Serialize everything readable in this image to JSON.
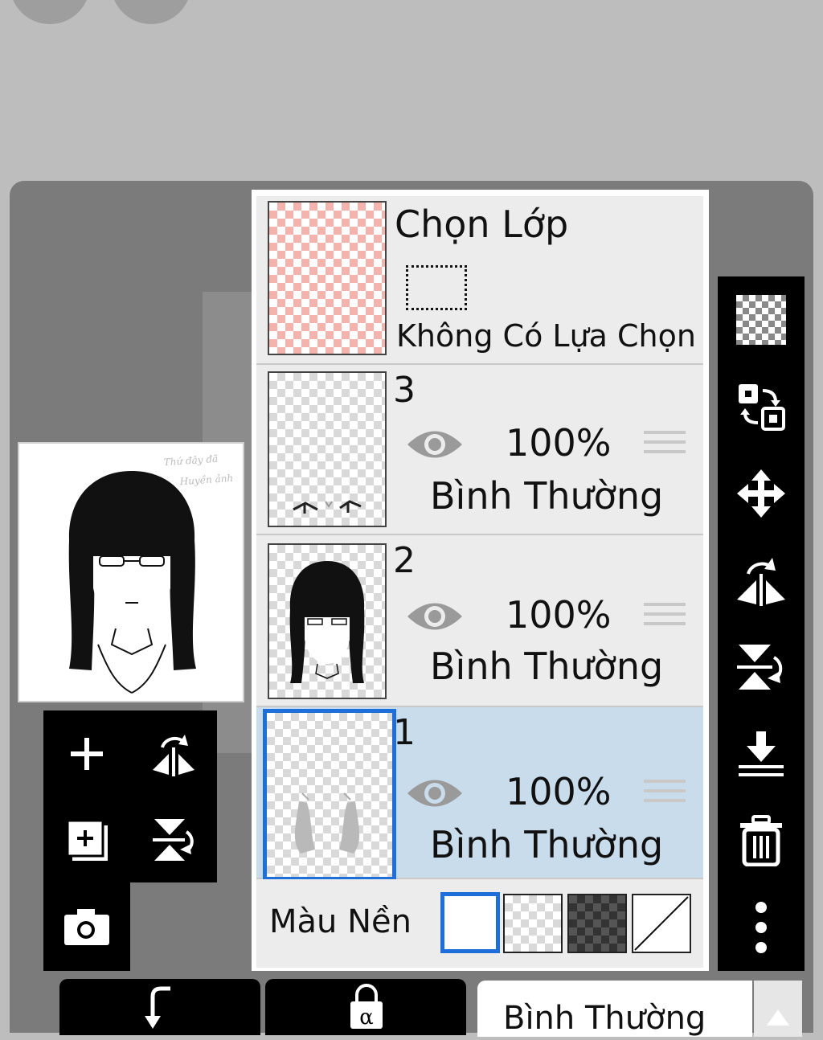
{
  "selection_layer": {
    "title": "Chọn Lớp",
    "status": "Không Có Lựa Chọn"
  },
  "layers": [
    {
      "number": "3",
      "opacity": "100%",
      "blend_mode": "Bình Thường",
      "selected": false
    },
    {
      "number": "2",
      "opacity": "100%",
      "blend_mode": "Bình Thường",
      "selected": false
    },
    {
      "number": "1",
      "opacity": "100%",
      "blend_mode": "Bình Thường",
      "selected": true
    }
  ],
  "background": {
    "label": "Màu Nền",
    "options": [
      "white",
      "transparent",
      "dark-checker",
      "none"
    ],
    "selected": "white"
  },
  "blend_select": {
    "value": "Bình Thường"
  },
  "left_tools": [
    "add-layer-icon",
    "flip-horizontal-icon",
    "add-layer-copy-icon",
    "flip-vertical-icon",
    "camera-icon"
  ],
  "right_tools": [
    "transparency-icon",
    "swap-layers-icon",
    "move-icon",
    "flip-horizontal-icon",
    "flip-vertical-icon",
    "merge-down-icon",
    "trash-icon",
    "more-icon"
  ],
  "bottom_tools": [
    "clip-icon",
    "alpha-lock-icon"
  ],
  "colors": {
    "selected_layer": "#c9dcec",
    "selection_blue": "#1e6fd9",
    "panel": "#7b7b7b",
    "toolbar": "#000000"
  }
}
